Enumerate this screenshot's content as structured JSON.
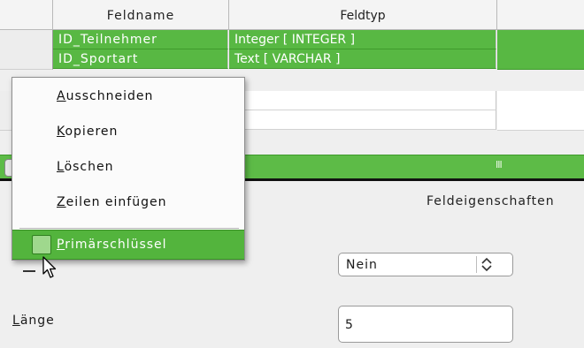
{
  "table": {
    "headers": [
      "",
      "Feldname",
      "Feldtyp",
      ""
    ],
    "rows": [
      {
        "name": "ID_Teilnehmer",
        "type": "Integer [ INTEGER ]"
      },
      {
        "name": "ID_Sportart",
        "type": "Text [ VARCHAR ]"
      }
    ],
    "scroll_grip": "III"
  },
  "properties": {
    "section_title": "Feldeigenschaften",
    "combo_value": "Nein",
    "laenge_label_underlined": "L",
    "laenge_label_rest": "änge",
    "laenge_value": "5"
  },
  "context_menu": {
    "items": [
      {
        "underlined": "A",
        "rest": "usschneiden"
      },
      {
        "underlined": "K",
        "rest": "opieren"
      },
      {
        "underlined": "L",
        "rest": "öschen"
      },
      {
        "underlined": "Z",
        "rest": "eilen einfügen"
      }
    ],
    "checked_item": {
      "underlined": "P",
      "rest": "rimärschlüssel"
    }
  },
  "colors": {
    "highlight": "#58b843",
    "menu_active": "#53b43d"
  }
}
